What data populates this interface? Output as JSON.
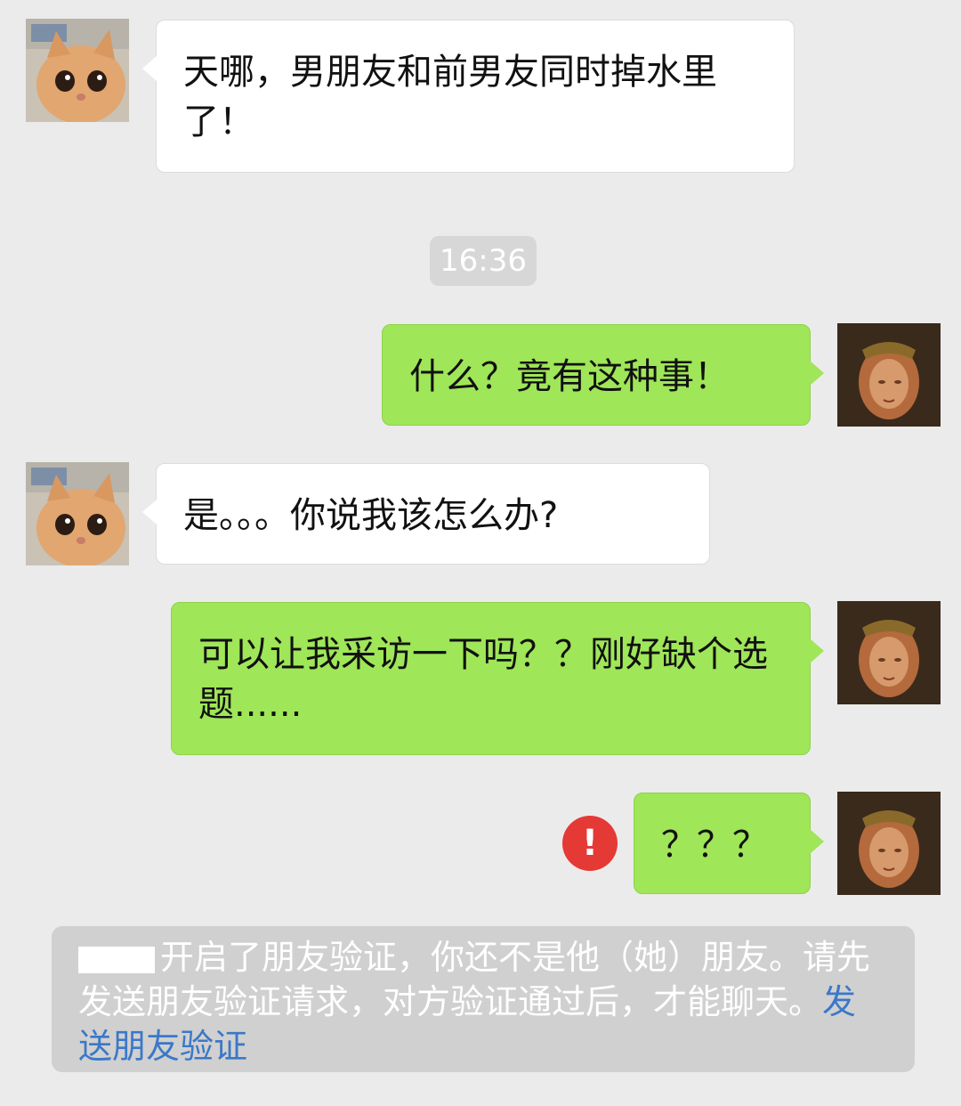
{
  "messages": [
    {
      "side": "in",
      "text": "天哪，男朋友和前男友同时掉水里了！"
    },
    {
      "side": "time",
      "text": "16:36"
    },
    {
      "side": "out",
      "text": "什么？竟有这种事！"
    },
    {
      "side": "in",
      "text": "是。。。你说我该怎么办?"
    },
    {
      "side": "out",
      "text": "可以让我采访一下吗？？刚好缺个选题......"
    },
    {
      "side": "out",
      "text": "？？？",
      "error_icon": "!"
    }
  ],
  "notice": {
    "text": "开启了朋友验证，你还不是他（她）朋友。请先发送朋友验证请求，对方验证通过后，才能聊天。",
    "link": "发送朋友验证"
  },
  "icons": {
    "contact_avatar": "cat-avatar-icon",
    "self_avatar": "painting-avatar-icon",
    "error": "error-icon"
  },
  "colors": {
    "background": "#ebebeb",
    "outgoing_bubble": "#9fe658",
    "incoming_bubble": "#ffffff",
    "error": "#e53935",
    "link": "#3b78c8"
  }
}
